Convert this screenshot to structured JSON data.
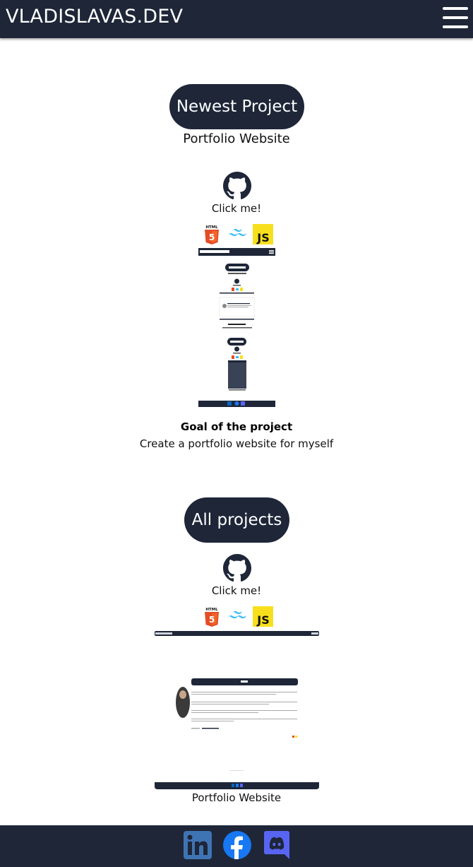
{
  "header": {
    "brand": "VLADISLAVAS.DEV",
    "menu_icon": "hamburger-menu-icon"
  },
  "newest": {
    "pill": "Newest Project",
    "title": "Portfolio Website",
    "github_icon": "github-icon",
    "click": "Click me!",
    "tech_icons": [
      "html5-icon",
      "tailwind-icon",
      "javascript-icon"
    ],
    "goal_heading": "Goal of the project",
    "goal_text": "Create a portfolio website for myself"
  },
  "all": {
    "pill": "All projects",
    "github_icon": "github-icon",
    "click": "Click me!",
    "tech_icons": [
      "html5-icon",
      "tailwind-icon",
      "javascript-icon"
    ],
    "caption": "Portfolio Website"
  },
  "footer": {
    "icons": [
      "linkedin-icon",
      "facebook-icon",
      "discord-icon"
    ]
  },
  "colors": {
    "navy": "#1e2638",
    "html": "#e44d26",
    "tailwind": "#38bdf8",
    "js": "#f7df1e",
    "facebook": "#1877f2",
    "discord": "#5865f2",
    "linkedin": "#0a66c2"
  }
}
